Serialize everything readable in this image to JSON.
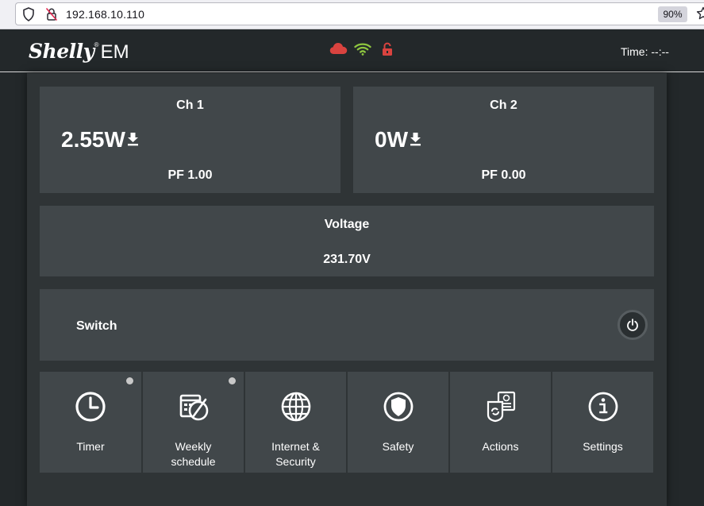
{
  "browser": {
    "url": "192.168.10.110",
    "zoom": "90%"
  },
  "header": {
    "brand": "Shelly",
    "model": "EM",
    "time_label": "Time: --:--",
    "status": {
      "cloud_color": "#d9433f",
      "wifi_color": "#8ec63f",
      "lock_color": "#d9433f"
    }
  },
  "channels": [
    {
      "title": "Ch 1",
      "power": "2.55W",
      "pf": "PF 1.00"
    },
    {
      "title": "Ch 2",
      "power": "0W",
      "pf": "PF 0.00"
    }
  ],
  "voltage": {
    "title": "Voltage",
    "value": "231.70V"
  },
  "switch": {
    "label": "Switch"
  },
  "tiles": [
    {
      "label": "Timer",
      "icon": "clock-icon"
    },
    {
      "label": "Weekly\nschedule",
      "icon": "schedule-icon"
    },
    {
      "label": "Internet &\nSecurity",
      "icon": "globe-icon"
    },
    {
      "label": "Safety",
      "icon": "shield-icon"
    },
    {
      "label": "Actions",
      "icon": "actions-icon"
    },
    {
      "label": "Settings",
      "icon": "info-icon"
    }
  ]
}
